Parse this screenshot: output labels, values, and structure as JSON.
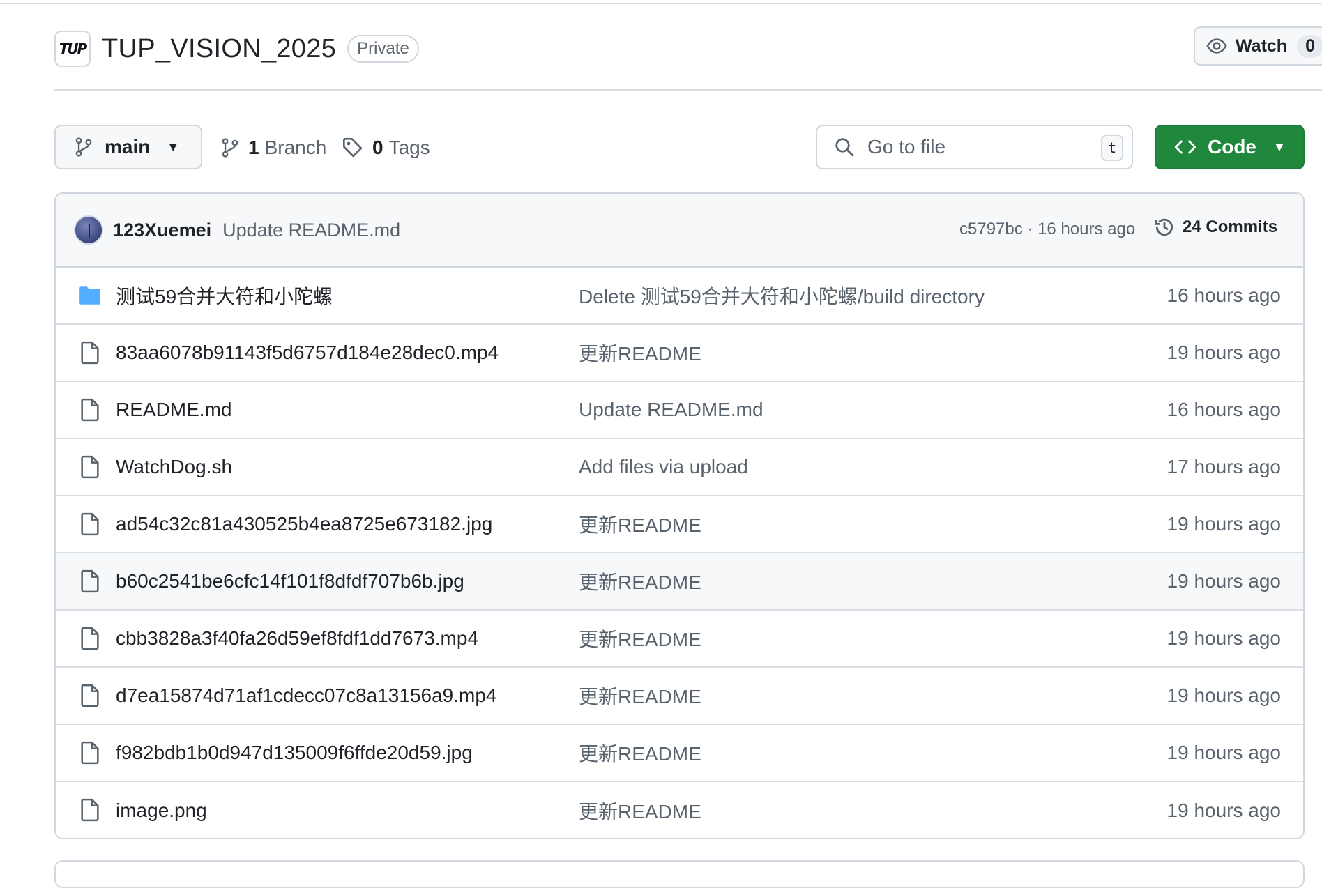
{
  "repo": {
    "logo_text": "TUP",
    "name": "TUP_VISION_2025",
    "visibility": "Private",
    "watch_label": "Watch",
    "watch_count": "0"
  },
  "toolbar": {
    "branch": "main",
    "branch_count": "1",
    "branch_label": "Branch",
    "tag_count": "0",
    "tag_label": "Tags",
    "goto_placeholder": "Go to file",
    "goto_shortcut": "t",
    "code_label": "Code"
  },
  "latest_commit": {
    "author": "123Xuemei",
    "message": "Update README.md",
    "hash_time": "c5797bc · 16 hours ago",
    "commits_count": "24",
    "commits_label": "Commits"
  },
  "files": [
    {
      "type": "folder",
      "name": "测试59合并大符和小陀螺",
      "message": "Delete 测试59合并大符和小陀螺/build directory",
      "time": "16 hours ago"
    },
    {
      "type": "file",
      "name": "83aa6078b91143f5d6757d184e28dec0.mp4",
      "message": "更新README",
      "time": "19 hours ago"
    },
    {
      "type": "file",
      "name": "README.md",
      "message": "Update README.md",
      "time": "16 hours ago"
    },
    {
      "type": "file",
      "name": "WatchDog.sh",
      "message": "Add files via upload",
      "time": "17 hours ago"
    },
    {
      "type": "file",
      "name": "ad54c32c81a430525b4ea8725e673182.jpg",
      "message": "更新README",
      "time": "19 hours ago"
    },
    {
      "type": "file",
      "name": "b60c2541be6cfc14f101f8dfdf707b6b.jpg",
      "message": "更新README",
      "time": "19 hours ago",
      "hover": true
    },
    {
      "type": "file",
      "name": "cbb3828a3f40fa26d59ef8fdf1dd7673.mp4",
      "message": "更新README",
      "time": "19 hours ago"
    },
    {
      "type": "file",
      "name": "d7ea15874d71af1cdecc07c8a13156a9.mp4",
      "message": "更新README",
      "time": "19 hours ago"
    },
    {
      "type": "file",
      "name": "f982bdb1b0d947d135009f6ffde20d59.jpg",
      "message": "更新README",
      "time": "19 hours ago"
    },
    {
      "type": "file",
      "name": "image.png",
      "message": "更新README",
      "time": "19 hours ago"
    }
  ],
  "colors": {
    "accent_green": "#1f883d",
    "folder_blue": "#54aeff",
    "muted_text": "#59636e",
    "border": "#d0d7de"
  },
  "icons": [
    "repo-logo",
    "eye-icon",
    "branch-icon",
    "tag-icon",
    "search-icon",
    "code-icon",
    "history-icon",
    "folder-icon",
    "file-icon",
    "chevron-down-icon"
  ]
}
